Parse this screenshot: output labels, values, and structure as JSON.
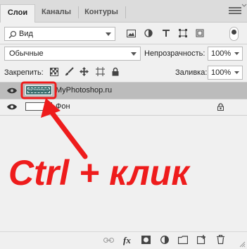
{
  "tabs": [
    {
      "label": "Слои",
      "active": true
    },
    {
      "label": "Каналы",
      "active": false
    },
    {
      "label": "Контуры",
      "active": false
    }
  ],
  "filter": {
    "kind_label": "Вид",
    "icons": [
      "image-filter-icon",
      "adjustment-filter-icon",
      "type-filter-icon",
      "shape-filter-icon",
      "smart-object-filter-icon"
    ]
  },
  "blend": {
    "mode": "Обычные",
    "opacity_label": "Непрозрачность:",
    "opacity_value": "100%"
  },
  "lock": {
    "label": "Закрепить:",
    "fill_label": "Заливка:",
    "fill_value": "100%"
  },
  "layers": [
    {
      "name": "MyPhotoshop.ru",
      "visible": true,
      "selected": true,
      "thumb_text": "MyPhotoshop.ru"
    },
    {
      "name": "Фон",
      "visible": true,
      "selected": false,
      "locked": true
    }
  ],
  "annotation": {
    "text": "Ctrl + клик",
    "color": "#ee1c1c"
  },
  "colors": {
    "selected_row": "#bcbcbc",
    "panel_bg": "#f0f0f0",
    "accent_red": "#ee1c1c"
  },
  "bottom_icons": [
    "link-layers-icon",
    "fx-icon",
    "layer-mask-icon",
    "adjustment-layer-icon",
    "new-group-icon",
    "new-layer-icon",
    "trash-icon"
  ],
  "bottom_fx_label": "fx"
}
